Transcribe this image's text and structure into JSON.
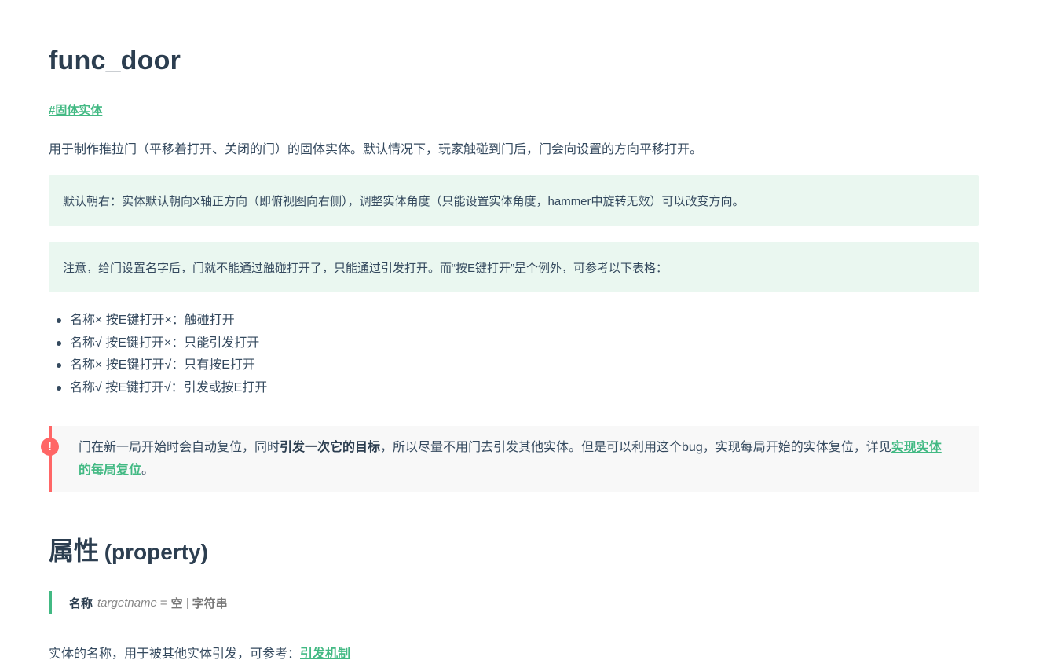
{
  "title": "func_door",
  "tag": "#固体实体",
  "intro": "用于制作推拉门（平移着打开、关闭的门）的固体实体。默认情况下，玩家触碰到门后，门会向设置的方向平移打开。",
  "tips": [
    "默认朝右：实体默认朝向X轴正方向（即俯视图向右侧），调整实体角度（只能设置实体角度，hammer中旋转无效）可以改变方向。",
    "注意，给门设置名字后，门就不能通过触碰打开了，只能通过引发打开。而“按E键打开”是个例外，可参考以下表格："
  ],
  "rules": [
    "名称× 按E键打开×：触碰打开",
    "名称√ 按E键打开×：只能引发打开",
    "名称× 按E键打开√：只有按E打开",
    "名称√ 按E键打开√：引发或按E打开"
  ],
  "warning": {
    "icon": "!",
    "text_before": "门在新一局开始时会自动复位，同时",
    "bold": "引发一次它的目标",
    "text_middle": "，所以尽量不用门去引发其他实体。但是可以利用这个bug，实现每局开始的实体复位，详见",
    "link": "实现实体的每局复位",
    "text_after": "。"
  },
  "section": {
    "title_zh": "属性",
    "title_en": "(property)"
  },
  "property": {
    "name": "名称",
    "key": "targetname",
    "eq": "=",
    "type1": "空",
    "sep": "|",
    "type2": "字符串"
  },
  "description": {
    "text": "实体的名称，用于被其他实体引发，可参考：",
    "link": "引发机制"
  },
  "colors": {
    "accent": "#42b983",
    "warning": "#ff6666",
    "tip_bg": "#eaf7f0",
    "text": "#34495e"
  }
}
